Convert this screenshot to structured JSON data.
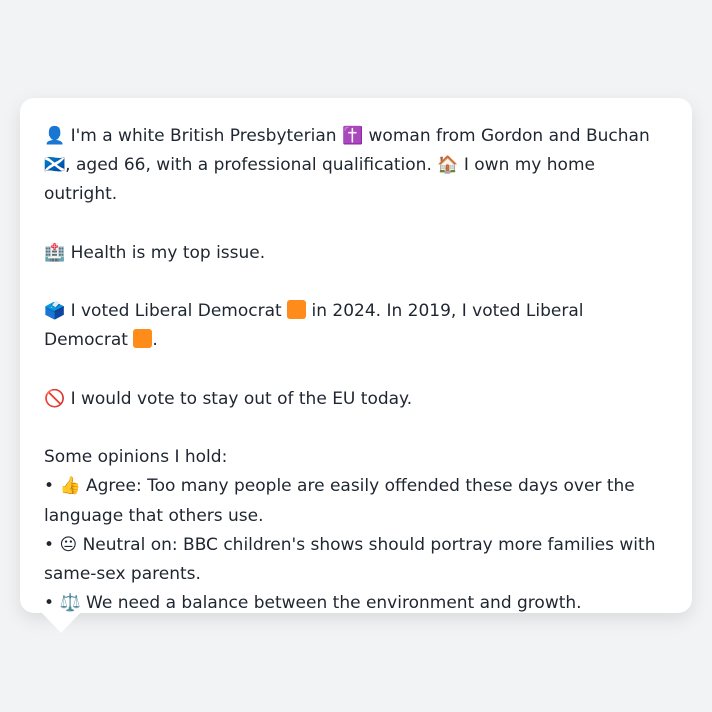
{
  "profile": {
    "identity_icon": "👤",
    "identity_prefix": "I'm a white British Presbyterian",
    "religion_icon": "✝️",
    "identity_middle": "woman from Gordon and Buchan",
    "flag_icon": "🏴󠁧󠁢󠁳󠁣󠁴󠁿",
    "identity_suffix": ",",
    "age_text": "aged 66, with a professional qualification.",
    "home_icon": "🏠",
    "home_text": "I own my home outright."
  },
  "issue": {
    "icon": "🏥",
    "text": "Health is my top issue."
  },
  "voting": {
    "ballot_icon": "🗳️",
    "prefix": "I voted Liberal Democrat",
    "party_color": "#ff8c1a",
    "middle": "in 2024. In 2019, I voted Liberal Democrat",
    "end": "."
  },
  "eu": {
    "icon": "🚫",
    "text": "I would vote to stay out of the EU today."
  },
  "opinions": {
    "heading": "Some opinions I hold:",
    "bullet": "•",
    "items": [
      {
        "icon": "👍",
        "text": "Agree: Too many people are easily offended these days over the language that others use."
      },
      {
        "icon": "😐",
        "text": "Neutral on: BBC children's shows should portray more families with same-sex parents."
      },
      {
        "icon": "⚖️",
        "text": "We need a balance between the environment and growth."
      }
    ]
  }
}
